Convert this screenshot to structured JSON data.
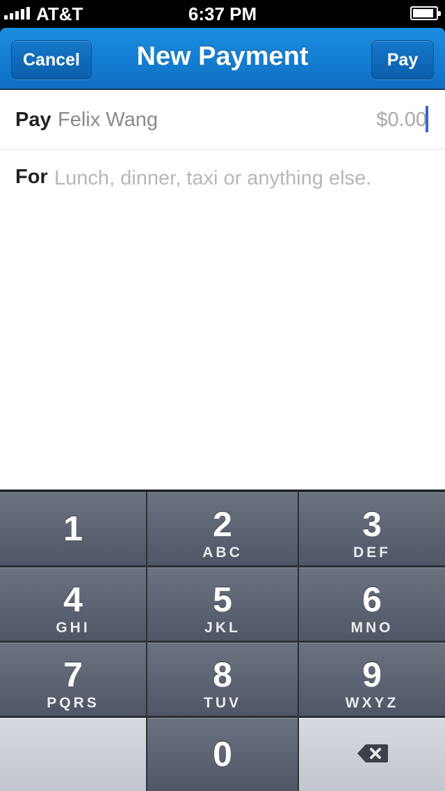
{
  "status_bar": {
    "carrier": "AT&T",
    "time": "6:37 PM",
    "signal_bars": 5,
    "battery_level": 0.9
  },
  "nav": {
    "cancel_label": "Cancel",
    "title": "New Payment",
    "pay_label": "Pay",
    "color": "#1580d6"
  },
  "form": {
    "pay_label": "Pay",
    "payee": "Felix Wang",
    "amount": "$0.00",
    "for_label": "For",
    "for_placeholder": "Lunch, dinner, taxi or anything else."
  },
  "keypad": {
    "keys": [
      {
        "num": "1",
        "letters": ""
      },
      {
        "num": "2",
        "letters": "ABC"
      },
      {
        "num": "3",
        "letters": "DEF"
      },
      {
        "num": "4",
        "letters": "GHI"
      },
      {
        "num": "5",
        "letters": "JKL"
      },
      {
        "num": "6",
        "letters": "MNO"
      },
      {
        "num": "7",
        "letters": "PQRS"
      },
      {
        "num": "8",
        "letters": "TUV"
      },
      {
        "num": "9",
        "letters": "WXYZ"
      },
      {
        "num": "0",
        "letters": ""
      }
    ],
    "delete_icon": "backspace-icon"
  }
}
